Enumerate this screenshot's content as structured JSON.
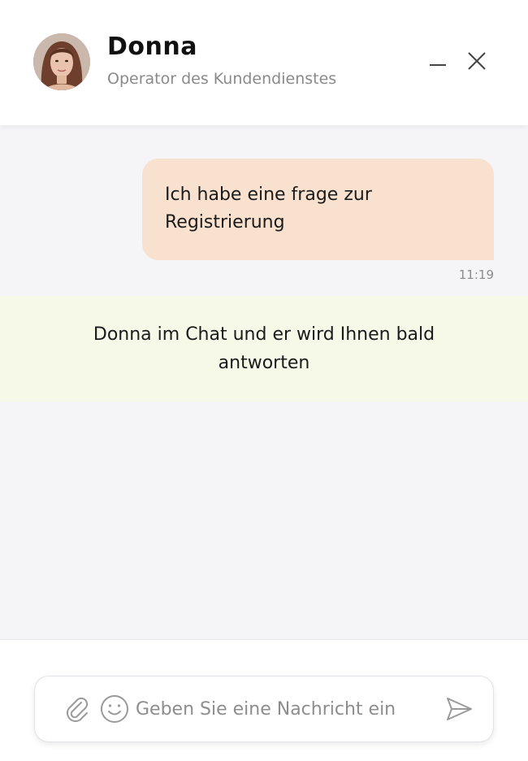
{
  "header": {
    "name": "Donna",
    "role": "Operator des Kundendienstes",
    "avatar_icon": "operator-avatar"
  },
  "conversation": {
    "messages": [
      {
        "from": "user",
        "text": "Ich habe eine frage zur Registrierung",
        "time": "11:19"
      }
    ],
    "notice": "Donna im Chat und er wird Ihnen bald antworten"
  },
  "composer": {
    "placeholder": "Geben Sie eine Nachricht ein",
    "value": ""
  },
  "colors": {
    "user_bubble": "#f9e1cf",
    "notice_bg": "#f6f9e8",
    "chat_bg": "#f5f5f8"
  }
}
